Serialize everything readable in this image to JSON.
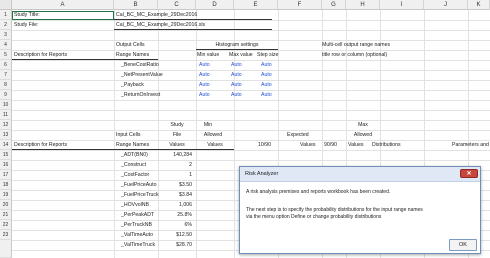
{
  "columns": [
    "A",
    "B",
    "C",
    "D",
    "E",
    "F",
    "G",
    "H",
    "I",
    "J",
    "K"
  ],
  "rows": [
    "1",
    "2",
    "3",
    "4",
    "5",
    "6",
    "7",
    "8",
    "9",
    "10",
    "11",
    "12",
    "13",
    "14",
    "15",
    "16",
    "17",
    "18",
    "19",
    "20",
    "21",
    "22",
    "23"
  ],
  "sheet": {
    "study_title_label": "Study Title:",
    "study_title_value": "Cal_BC_MC_Example_29Dec2016",
    "study_file_label": "Study File:",
    "study_file_value": "Cal_BC_MC_Example_29Dec2016.xls",
    "output_cells_label": "Output Cells",
    "histogram_settings": "Histogram settings",
    "multicell_header": "Multi-cell output range names",
    "desc_reports_1": "Description for Reports",
    "range_names_1": "Range Names",
    "min_value": "Min value",
    "max_value": "Max value",
    "step_size": "Step size",
    "title_note": "title row or column (optional)",
    "outputs": [
      {
        "name": "_BeneCostRatio",
        "min": "Auto",
        "max": "Auto",
        "step": "Auto"
      },
      {
        "name": "_NetPresentValue",
        "min": "Auto",
        "max": "Auto",
        "step": "Auto"
      },
      {
        "name": "_Payback",
        "min": "Auto",
        "max": "Auto",
        "step": "Auto"
      },
      {
        "name": "_ReturnOnInvest",
        "min": "Auto",
        "max": "Auto",
        "step": "Auto"
      }
    ],
    "study": "Study",
    "min": "Min",
    "max": "Max",
    "input_cells": "Input Cells",
    "file": "File",
    "allowed_1": "Allowed",
    "expected": "Expected",
    "allowed_2": "Allowed",
    "desc_reports_2": "Description for Reports",
    "range_names_2": "Range Names",
    "values_1": "Values",
    "values_2": "Values",
    "p1090": "10/90",
    "values_3": "Values",
    "p9090": "90/90",
    "values_4": "Values",
    "distributions": "Distributions",
    "parameters": "Parameters and",
    "inputs": [
      {
        "name": "_ADT(BN0)",
        "value": "140,284"
      },
      {
        "name": "_Construct",
        "value": "2"
      },
      {
        "name": "_CostFactor",
        "value": "1"
      },
      {
        "name": "_FuelPriceAuto",
        "value": "$3.50"
      },
      {
        "name": "_FuelPriceTruck",
        "value": "$3.84"
      },
      {
        "name": "_HOVvolNB",
        "value": "1,006"
      },
      {
        "name": "_PerPeakADT",
        "value": "25.8%"
      },
      {
        "name": "_PerTruckNB",
        "value": "6%"
      },
      {
        "name": "_ValTimeAuto",
        "value": "$12.50"
      },
      {
        "name": "_ValTimeTruck",
        "value": "$28.70"
      }
    ]
  },
  "dialog": {
    "title": "Risk Analyzer",
    "close_glyph": "✕",
    "line1": "A risk analysis premises and reports workbook has been created.",
    "line2": "The next step is to specify the probability distributions for the input range names",
    "line3": "via the menu option Define or change probability distributions",
    "ok_label": "OK"
  }
}
